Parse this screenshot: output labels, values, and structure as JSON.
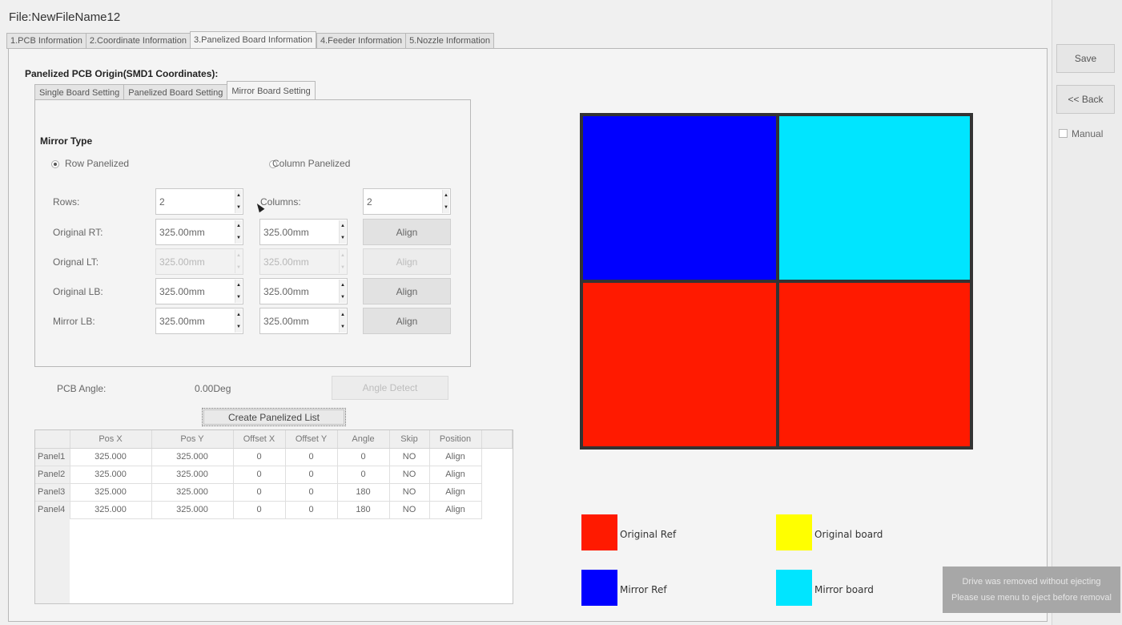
{
  "title": "File:NewFileName12",
  "tabs": [
    {
      "label": "1.PCB Information"
    },
    {
      "label": "2.Coordinate Information"
    },
    {
      "label": "3.Panelized Board Information"
    },
    {
      "label": "4.Feeder Information"
    },
    {
      "label": "5.Nozzle Information"
    }
  ],
  "origin_heading": "Panelized PCB Origin(SMD1 Coordinates):",
  "subtabs": [
    {
      "label": "Single Board Setting"
    },
    {
      "label": "Panelized Board Setting"
    },
    {
      "label": "Mirror Board Setting"
    }
  ],
  "mirror": {
    "type_label": "Mirror Type",
    "row_label": "Row Panelized",
    "column_label": "Column Panelized",
    "rows_label": "Rows:",
    "rows_value": "2",
    "columns_label": "Columns:",
    "columns_value": "2",
    "rt_label": "Original RT:",
    "rt_x": "325.00mm",
    "rt_y": "325.00mm",
    "lt_label": "Orignal LT:",
    "lt_x": "325.00mm",
    "lt_y": "325.00mm",
    "lb_label": "Original LB:",
    "lb_x": "325.00mm",
    "lb_y": "325.00mm",
    "mlb_label": "Mirror LB:",
    "mlb_x": "325.00mm",
    "mlb_y": "325.00mm",
    "align_label": "Align"
  },
  "angle": {
    "label": "PCB Angle:",
    "value": "0.00Deg",
    "detect_label": "Angle Detect"
  },
  "create_label": "Create Panelized List",
  "table": {
    "headers": [
      "Pos X",
      "Pos Y",
      "Offset X",
      "Offset Y",
      "Angle",
      "Skip",
      "Position"
    ],
    "rows": [
      {
        "name": "Panel1",
        "posx": "325.000",
        "posy": "325.000",
        "offx": "0",
        "offy": "0",
        "angle": "0",
        "skip": "NO",
        "position": "Align"
      },
      {
        "name": "Panel2",
        "posx": "325.000",
        "posy": "325.000",
        "offx": "0",
        "offy": "0",
        "angle": "0",
        "skip": "NO",
        "position": "Align"
      },
      {
        "name": "Panel3",
        "posx": "325.000",
        "posy": "325.000",
        "offx": "0",
        "offy": "0",
        "angle": "180",
        "skip": "NO",
        "position": "Align"
      },
      {
        "name": "Panel4",
        "posx": "325.000",
        "posy": "325.000",
        "offx": "0",
        "offy": "0",
        "angle": "180",
        "skip": "NO",
        "position": "Align"
      }
    ]
  },
  "colors": {
    "original_ref": "#ff1a00",
    "original_board": "#ffff00",
    "mirror_ref": "#0000ff",
    "mirror_board": "#00e5ff"
  },
  "legend": {
    "original_ref": "Original Ref",
    "original_board": "Original board",
    "mirror_ref": "Mirror Ref",
    "mirror_board": "Mirror board"
  },
  "sidebar": {
    "save_label": "Save",
    "back_label": "<< Back",
    "manual_label": "Manual"
  },
  "toast": {
    "line1": "Drive was removed without ejecting",
    "line2": "Please use menu to eject before removal"
  }
}
